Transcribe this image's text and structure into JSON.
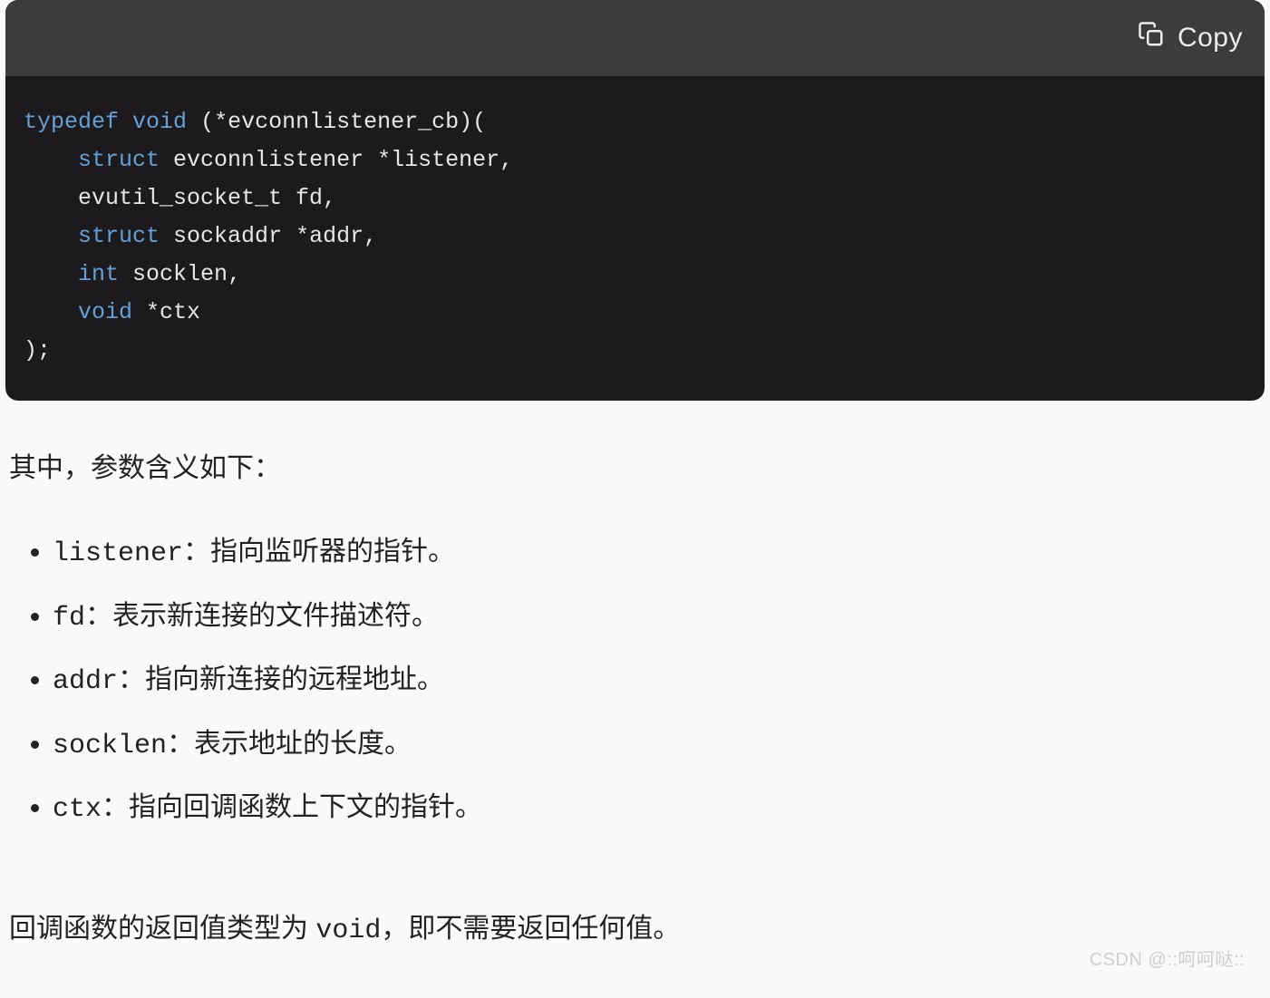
{
  "code_block": {
    "copy_label": "Copy",
    "t_typedef": "typedef",
    "t_void": "void",
    "t_fname": "(*evconnlistener_cb)(",
    "t_struct1": "struct",
    "t_param1": "evconnlistener *listener,",
    "t_param2": "evutil_socket_t fd,",
    "t_struct2": "struct",
    "t_param3": "sockaddr *addr,",
    "t_int": "int",
    "t_param4": "socklen,",
    "t_void2": "void",
    "t_param5": "*ctx",
    "t_close": ");"
  },
  "content": {
    "intro": "其中，参数含义如下：",
    "params": [
      {
        "name": "listener",
        "desc": "：指向监听器的指针。"
      },
      {
        "name": "fd",
        "desc": "：表示新连接的文件描述符。"
      },
      {
        "name": "addr",
        "desc": "：指向新连接的远程地址。"
      },
      {
        "name": "socklen",
        "desc": "：表示地址的长度。"
      },
      {
        "name": "ctx",
        "desc": "：指向回调函数上下文的指针。"
      }
    ],
    "return_pre": "回调函数的返回值类型为 ",
    "return_type": "void",
    "return_post": "，即不需要返回任何值。"
  },
  "watermark": "CSDN @::呵呵哒::"
}
